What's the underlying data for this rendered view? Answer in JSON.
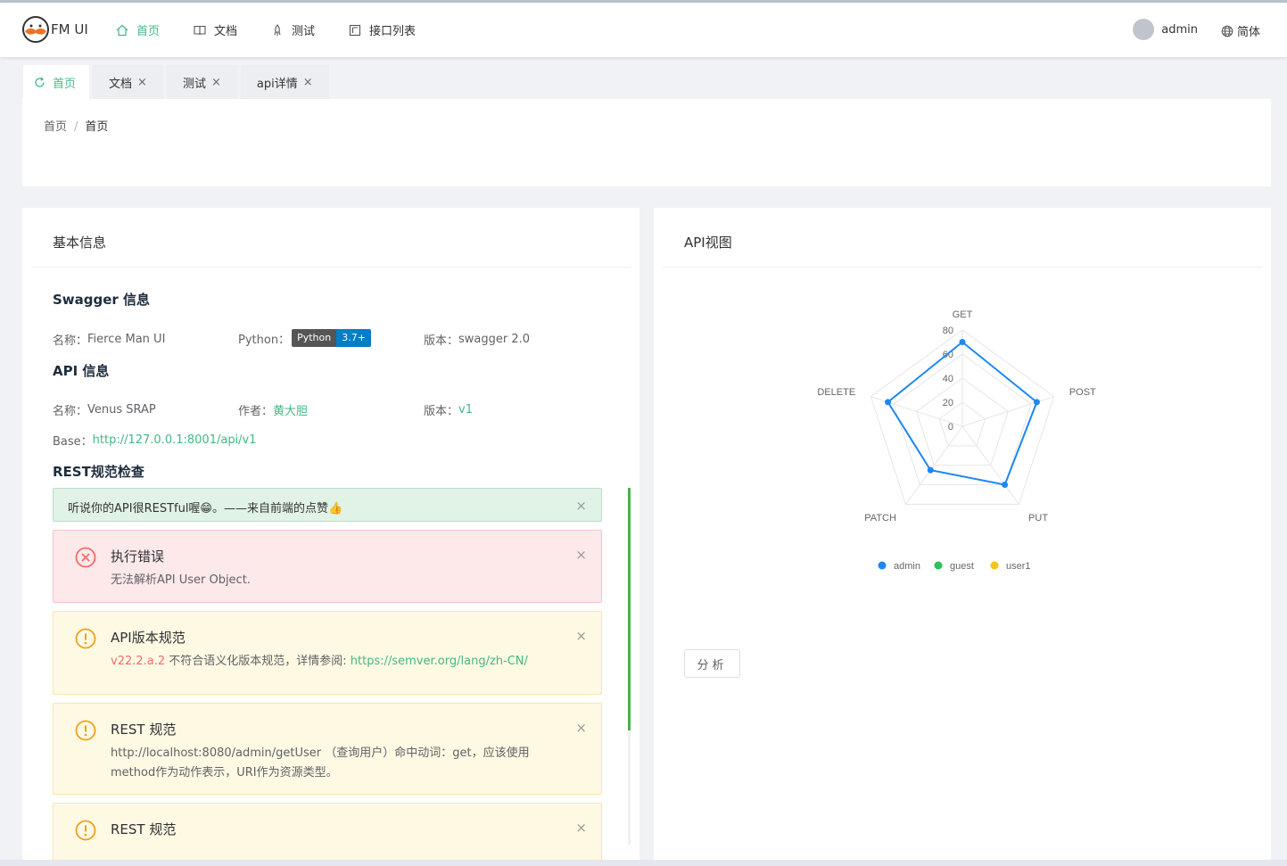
{
  "app": {
    "title": "FM UI"
  },
  "nav": [
    {
      "label": "首页",
      "icon": "home-icon"
    },
    {
      "label": "文档",
      "icon": "book-icon"
    },
    {
      "label": "测试",
      "icon": "rocket-icon"
    },
    {
      "label": "接口列表",
      "icon": "list-icon"
    }
  ],
  "user": {
    "name": "admin"
  },
  "lang": {
    "label": "简体"
  },
  "tabs": [
    {
      "label": "首页"
    },
    {
      "label": "文档",
      "close": "×"
    },
    {
      "label": "测试",
      "close": "×"
    },
    {
      "label": "api详情",
      "close": "×"
    }
  ],
  "breadcrumb": {
    "root": "首页",
    "sep": "/",
    "current": "首页"
  },
  "left": {
    "title": "基本信息",
    "swagger": {
      "heading": "Swagger 信息",
      "name_label": "名称：",
      "name": "Fierce Man UI",
      "python_label": "Python：",
      "badge_left": "Python",
      "badge_right": "3.7+",
      "version_label": "版本：",
      "version": "swagger 2.0"
    },
    "api": {
      "heading": "API 信息",
      "name_label": "名称：",
      "name": "Venus SRAP",
      "author_label": "作者：",
      "author": "黄大胆",
      "version_label": "版本：",
      "version": "v1",
      "base_label": "Base：",
      "base": "http://127.0.0.1:8001/api/v1"
    },
    "rest": {
      "heading": "REST规范检查",
      "success": "听说你的API很RESTful喔😁。——来自前端的点赞👍",
      "error_title": "执行错误",
      "error_desc": "无法解析API User Object.",
      "warn1_title": "API版本规范",
      "warn1_ver": "v22.2.a.2",
      "warn1_text": " 不符合语义化版本规范，详情参阅: ",
      "warn1_link": "https://semver.org/lang/zh-CN/",
      "warn2_title": "REST 规范",
      "warn2_desc": "http://localhost:8080/admin/getUser （查询用户）命中动词：get，应该使用method作为动作表示，URI作为资源类型。",
      "warn3_title": "REST 规范",
      "close": "×"
    }
  },
  "right": {
    "title": "API视图",
    "button": "分析"
  },
  "chart_data": {
    "type": "radar",
    "indicators": [
      "GET",
      "POST",
      "PUT",
      "PATCH",
      "DELETE"
    ],
    "max": 80,
    "ticks": [
      0,
      20,
      40,
      60,
      80
    ],
    "series": [
      {
        "name": "admin",
        "values": [
          70,
          65,
          60,
          45,
          65
        ],
        "color": "#1e88f0"
      }
    ],
    "legend": [
      {
        "name": "admin",
        "color": "#1e88f0"
      },
      {
        "name": "guest",
        "color": "#2ec05a"
      },
      {
        "name": "user1",
        "color": "#f5c518"
      }
    ],
    "legend_position": "bottom"
  }
}
